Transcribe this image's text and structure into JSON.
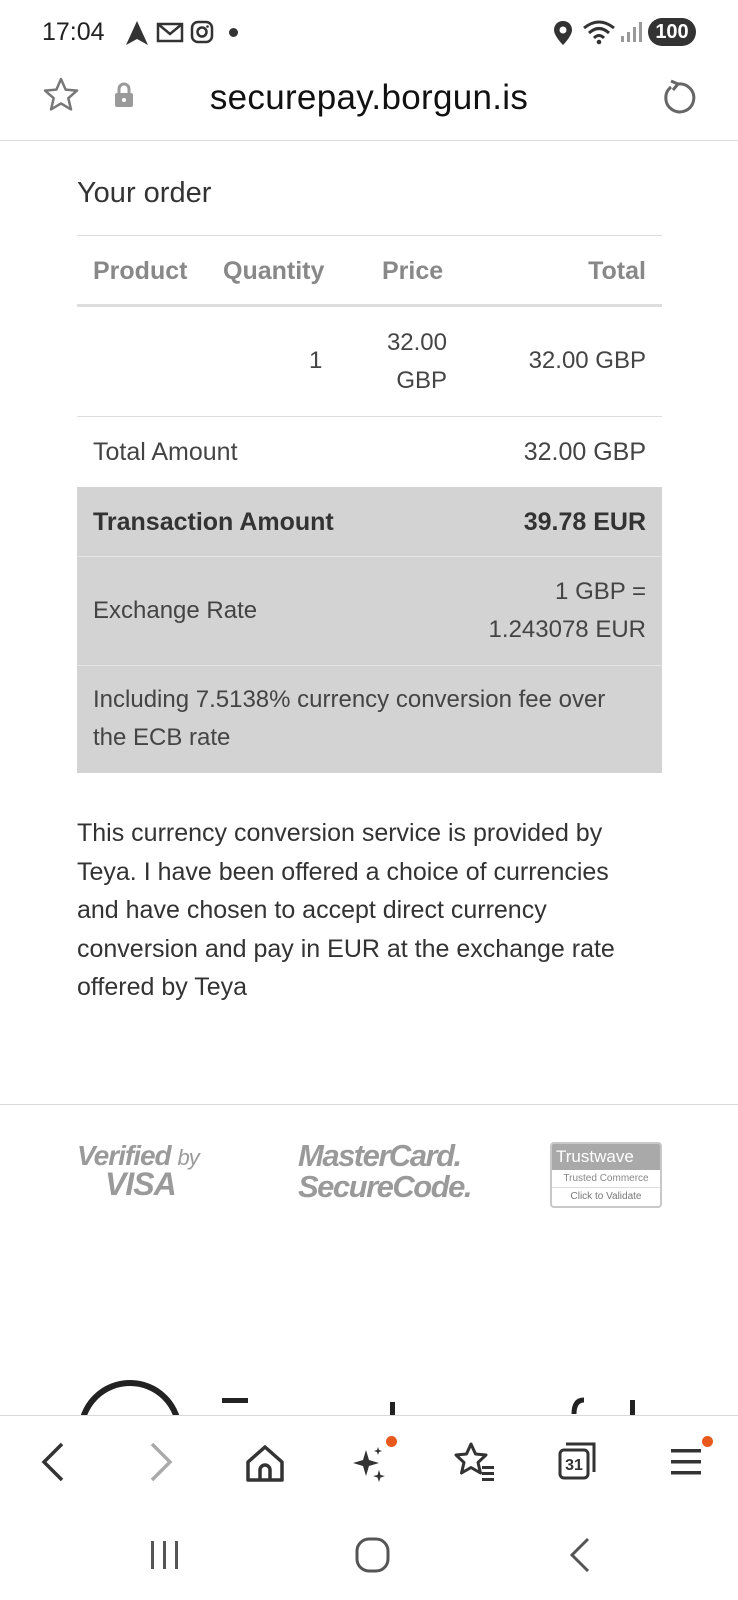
{
  "status_bar": {
    "time": "17:04",
    "battery": "100"
  },
  "url_bar": {
    "url": "securepay.borgun.is"
  },
  "order": {
    "title": "Your order",
    "headers": {
      "product": "Product",
      "quantity": "Quantity",
      "price": "Price",
      "total": "Total"
    },
    "item": {
      "product": "",
      "quantity": "1",
      "price_line1": "32.00",
      "price_line2": "GBP",
      "total": "32.00 GBP"
    },
    "total_amount": {
      "label": "Total Amount",
      "value": "32.00 GBP"
    },
    "transaction_amount": {
      "label": "Transaction Amount",
      "value": "39.78 EUR"
    },
    "exchange_rate": {
      "label": "Exchange Rate",
      "value_line1": "1 GBP =",
      "value_line2": "1.243078 EUR"
    },
    "fee_note": "Including 7.5138% currency conversion fee over the ECB rate"
  },
  "disclaimer": "This currency conversion service is provided by Teya. I have been offered a choice of currencies and have chosen to accept direct currency conversion and pay in EUR at the exchange rate offered by Teya",
  "badges": {
    "visa_line1": "Verified",
    "visa_by": "by",
    "visa_line2": "VISA",
    "mastercard_line1": "MasterCard.",
    "mastercard_line2": "SecureCode.",
    "trustwave_title": "Trustwave",
    "trustwave_sub": "Trusted Commerce",
    "trustwave_cta": "Click to Validate"
  },
  "bottom_toolbar": {
    "icons": [
      "back-icon",
      "forward-icon",
      "home-icon",
      "ai-sparkle-icon",
      "bookmarks-icon",
      "tabs-icon",
      "menu-icon"
    ],
    "tabs_count": "31"
  },
  "colors": {
    "grey_panel": "#d3d3d3",
    "notification_dot": "#e8591d"
  }
}
